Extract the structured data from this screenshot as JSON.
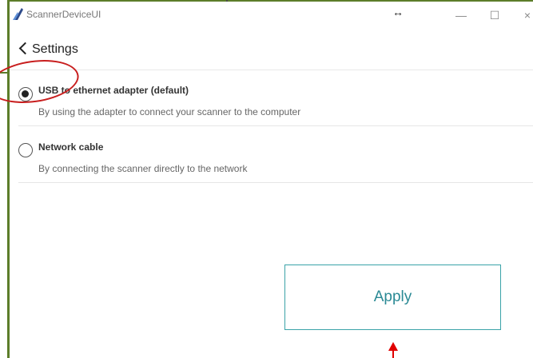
{
  "window": {
    "app_title": "ScannerDeviceUI",
    "resize_glyph": "↔",
    "minimize_glyph": "—",
    "maximize_glyph": "☐",
    "close_glyph": "×"
  },
  "header": {
    "back_label": "Settings"
  },
  "options": [
    {
      "title": "USB to ethernet adapter (default)",
      "description": "By using the adapter to connect your scanner to the computer",
      "selected": true
    },
    {
      "title": "Network cable",
      "description": "By connecting the scanner directly to the network",
      "selected": false
    }
  ],
  "actions": {
    "apply_label": "Apply"
  },
  "colors": {
    "accent": "#2b8a95",
    "frame": "#5c7d2a",
    "annotation": "#c81e1e"
  }
}
